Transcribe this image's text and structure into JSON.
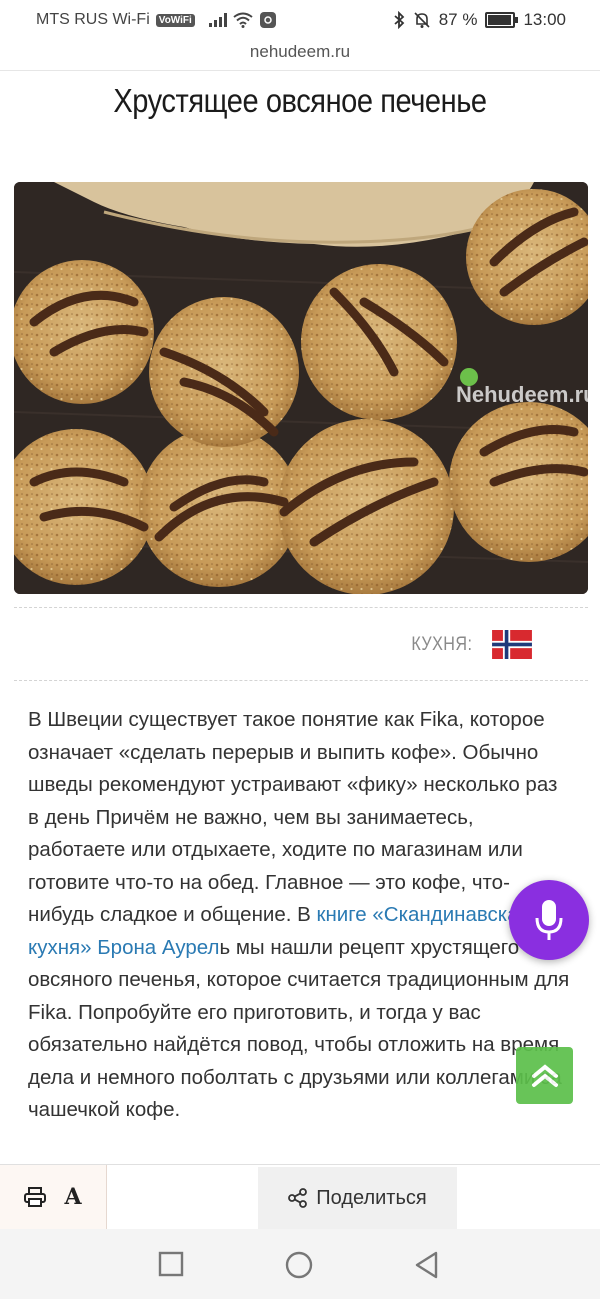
{
  "status_bar": {
    "carrier": "MTS RUS Wi-Fi",
    "vowifi": "VoWiFi",
    "battery_percent": "87 %",
    "battery_level": 0.87,
    "time": "13:00"
  },
  "browser": {
    "url": "nehudeem.ru"
  },
  "article": {
    "title": "Хрустящее овсяное печенье",
    "cuisine_label": "КУХНЯ:",
    "cuisine_flag": "norway-flag",
    "photo_watermark": "Nehudeem.ru",
    "text_part1": "В Швеции существует такое понятие как Fika, которое означает «сделать перерыв и выпить кофе». Обычно шведы рекомендуют устраивают «фику» несколько раз в день Причём не важно, чем вы занимаетесь, работаете или отдыхаете, ходите по магазинам или готовите что-то на обед. Главное — это кофе, что-нибудь сладкое и общение. В ",
    "link_text": "книге «Скандинавская кухня» Брона Аурел",
    "text_part2": "ь мы нашли рецепт хрустящего овсяного печенья, которое считается традиционным для Fika. Попробуйте его приготовить, и тогда у вас обязательно найдётся повод, чтобы отложить на время дела и немного поболтать с друзьями или коллегами за чашечкой кофе."
  },
  "toolbar": {
    "print_icon": "printer-icon",
    "font_icon": "A",
    "share_label": "Поделиться",
    "share_icon": "share-icon"
  },
  "colors": {
    "link": "#2a7ab3",
    "mic_button": "#8a2fe0",
    "scroll_top_button": "#5cbf4a"
  }
}
